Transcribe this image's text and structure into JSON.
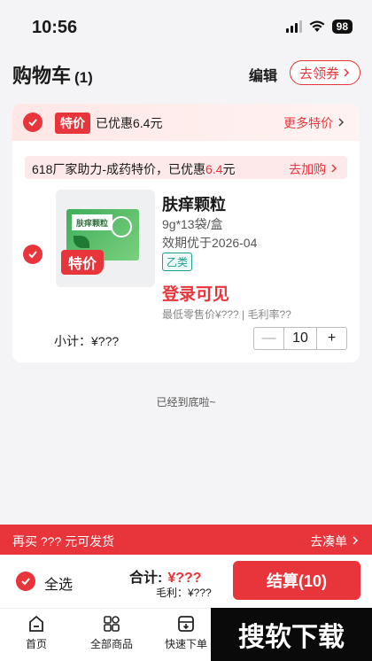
{
  "status": {
    "time": "10:56",
    "battery": "98"
  },
  "header": {
    "title": "购物车",
    "count": "(1)",
    "edit": "编辑",
    "coupon": "去领券"
  },
  "promo": {
    "tag": "特价",
    "saved": "已优惠6.4元",
    "more": "更多特价"
  },
  "factory": {
    "text_prefix": "618厂家助力-成药特价，已优惠",
    "amount": "6.4",
    "text_suffix": "元",
    "action": "去加购"
  },
  "product": {
    "image_badge": "特价",
    "box_label": "肤痒颗粒",
    "name": "肤痒颗粒",
    "spec": "9g*13袋/盒",
    "expiry": "效期优于2026-04",
    "class": "乙类",
    "price_hint": "登录可见",
    "retail": "最低零售价¥??? | 毛利率??",
    "subtotal": "小计：¥???",
    "quantity": "10"
  },
  "bottom_tip": "已经到底啦~",
  "free_ship": {
    "text": "再买 ???  元可发货",
    "action": "去凑单"
  },
  "checkout": {
    "select_all": "全选",
    "total_label": "合计:",
    "total_value": "¥???",
    "margin": "毛利：¥???",
    "settle": "结算(10)"
  },
  "tabs": [
    "首页",
    "全部商品",
    "快速下单"
  ],
  "watermark": "搜软下载",
  "colors": {
    "accent": "#e8353b",
    "teal": "#1aa090"
  }
}
